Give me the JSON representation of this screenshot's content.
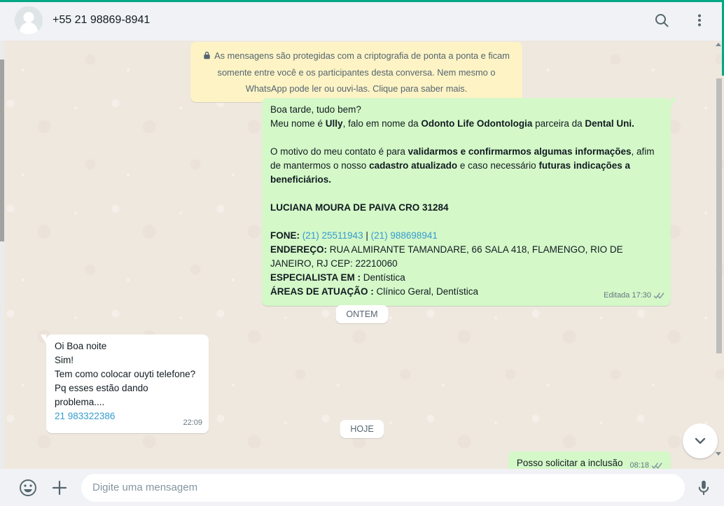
{
  "colors": {
    "accent_teal": "#00a884",
    "header_bg": "#f0f2f5",
    "chat_bg": "#efe8df",
    "outgoing_bubble": "#d4f8c8",
    "incoming_bubble": "#ffffff",
    "banner_yellow": "#fdf3c5",
    "link_blue": "#359bcf",
    "meta_gray": "#667781"
  },
  "header": {
    "phone": "+55 21 98869-8941"
  },
  "encryption_banner": {
    "icon": "lock-icon",
    "text": "As mensagens são protegidas com a criptografia de ponta a ponta e ficam somente entre você e os participantes desta conversa. Nem mesmo o WhatsApp pode ler ou ouvi-las. Clique para saber mais."
  },
  "date_dividers": {
    "yesterday": "ONTEM",
    "today": "HOJE"
  },
  "messages": [
    {
      "direction": "out",
      "lines": [
        [
          {
            "t": "Boa tarde, tudo bem?"
          }
        ],
        [
          {
            "t": "Meu nome é "
          },
          {
            "t": "Ully",
            "b": true
          },
          {
            "t": ", falo em nome da "
          },
          {
            "t": "Odonto Life Odontologia",
            "b": true
          },
          {
            "t": " parceira da "
          },
          {
            "t": "Dental Uni.",
            "b": true
          }
        ],
        [],
        [
          {
            "t": "O motivo do meu contato é para "
          },
          {
            "t": "validarmos e confirmarmos algumas informações",
            "b": true
          },
          {
            "t": ", afim de mantermos o nosso "
          },
          {
            "t": "cadastro atualizado",
            "b": true
          },
          {
            "t": " e caso necessário "
          },
          {
            "t": "futuras indicações a beneficiários.",
            "b": true
          }
        ],
        [],
        [
          {
            "t": "LUCIANA MOURA DE PAIVA CRO 31284",
            "b": true
          }
        ],
        [],
        [
          {
            "t": "FONE: ",
            "b": true
          },
          {
            "t": "(21) 25511943",
            "link": true
          },
          {
            "t": " | "
          },
          {
            "t": "(21) 988698941",
            "link": true
          }
        ],
        [
          {
            "t": "ENDEREÇO: ",
            "b": true
          },
          {
            "t": "RUA ALMIRANTE TAMANDARE, 66 SALA 418, FLAMENGO, RIO DE JANEIRO, RJ CEP: 22210060"
          }
        ],
        [
          {
            "t": "ESPECIALISTA EM : ",
            "b": true
          },
          {
            "t": "Dentística"
          }
        ],
        [
          {
            "t": "ÁREAS DE ATUAÇÃO : ",
            "b": true
          },
          {
            "t": "Clínico Geral, Dentística"
          }
        ]
      ],
      "meta": {
        "edited_label": "Editada",
        "time": "17:30",
        "status": "delivered"
      }
    },
    {
      "direction": "in",
      "lines": [
        [
          {
            "t": "Oi Boa noite"
          }
        ],
        [
          {
            "t": "Sim!"
          }
        ],
        [
          {
            "t": "Tem como colocar ouyti telefone?"
          }
        ],
        [
          {
            "t": "Pq esses estão dando problema...."
          }
        ],
        [
          {
            "t": "21 983322386",
            "link": true
          }
        ]
      ],
      "meta": {
        "time": "22:09",
        "status": "none"
      }
    },
    {
      "direction": "out",
      "lines": [
        [
          {
            "t": "Posso solicitar a inclusão"
          }
        ]
      ],
      "meta": {
        "time": "08:18",
        "status": "delivered"
      }
    }
  ],
  "composer": {
    "placeholder": "Digite uma mensagem"
  }
}
